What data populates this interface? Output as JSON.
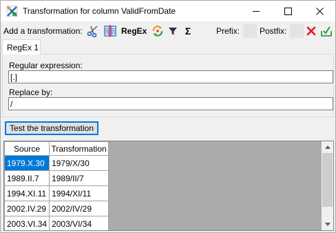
{
  "window": {
    "title": "Transformation for column ValidFromDate",
    "controls": {
      "minimize": "minimize",
      "maximize": "maximize",
      "close": "close"
    }
  },
  "toolbar": {
    "label": "Add a transformation:",
    "regex_label": "RegEx",
    "sigma_label": "Σ",
    "prefix_label": "Prefix:",
    "postfix_label": "Postfix:",
    "icons": [
      "scissors-icon",
      "split-columns-icon",
      "regex",
      "convert-icon",
      "filter-icon",
      "sigma-icon",
      "delete-icon",
      "apply-icon"
    ]
  },
  "tabs": [
    {
      "label": "RegEx 1",
      "active": true
    }
  ],
  "regex_panel": {
    "regex_label": "Regular expression:",
    "regex_value": "[.]",
    "replace_label": "Replace by:",
    "replace_value": "/"
  },
  "test_button": "Test the transformation",
  "grid": {
    "columns": [
      "Source",
      "Transformation"
    ],
    "rows": [
      {
        "source": "1979.X.30",
        "transformation": "1979/X/30",
        "selected": true
      },
      {
        "source": "1989.II.7",
        "transformation": "1989/II/7",
        "selected": false
      },
      {
        "source": "1994.XI.11",
        "transformation": "1994/XI/11",
        "selected": false
      },
      {
        "source": "2002.IV.29",
        "transformation": "2002/IV/29",
        "selected": false
      },
      {
        "source": "2003.VI.34",
        "transformation": "2003/VI/34",
        "selected": false
      }
    ]
  },
  "colors": {
    "selection": "#0078d7",
    "delete": "#e81123",
    "apply": "#2e9e3f"
  }
}
